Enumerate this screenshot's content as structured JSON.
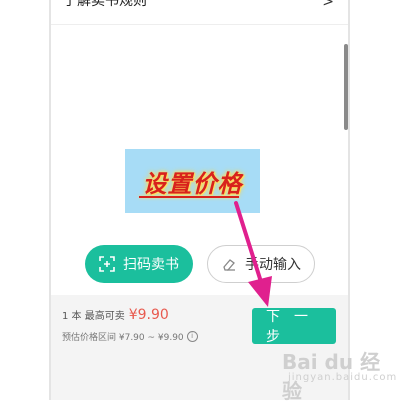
{
  "header": {
    "rules_link": "了解卖书规则"
  },
  "overlay": {
    "caption": "设置价格"
  },
  "actions": {
    "scan_label": "扫码卖书",
    "manual_label": "手动输入"
  },
  "summary": {
    "count_label": "1 本 最高可卖",
    "max_price": "¥9.90",
    "range_label": "预估价格区间 ¥7.90 ~ ¥9.90"
  },
  "footer": {
    "next_label": "下一步"
  },
  "watermark": {
    "logo_text": "Bai du 经验",
    "sub_text": "jingyan.baidu.com"
  },
  "colors": {
    "accent": "#1bbf9d",
    "price": "#e85a4f",
    "annotation_arrow": "#e0208e"
  },
  "icons": [
    "chevron-right-icon",
    "scan-icon",
    "eraser-icon",
    "info-icon"
  ]
}
